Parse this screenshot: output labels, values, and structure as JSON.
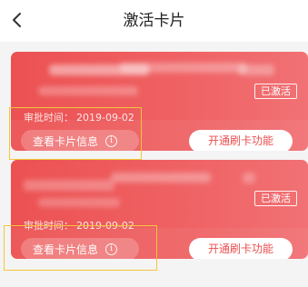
{
  "header": {
    "title": "激活卡片",
    "back_icon": "chevron-left-icon"
  },
  "cards": [
    {
      "status": "已激活",
      "approval_label": "审批时间：",
      "approval_date": "2019-09-02",
      "info_button": "查看卡片信息",
      "info_icon": "info-circle-icon",
      "action_button": "开通刷卡功能"
    },
    {
      "status": "已激活",
      "approval_label": "审批时间：",
      "approval_date": "2019-09-02",
      "info_button": "查看卡片信息",
      "info_icon": "info-circle-icon",
      "action_button": "开通刷卡功能"
    }
  ],
  "colors": {
    "card_gradient_start": "#ec5152",
    "card_gradient_end": "#f17174",
    "highlight_border": "#f3c63a",
    "button_text": "#ec4f50"
  }
}
